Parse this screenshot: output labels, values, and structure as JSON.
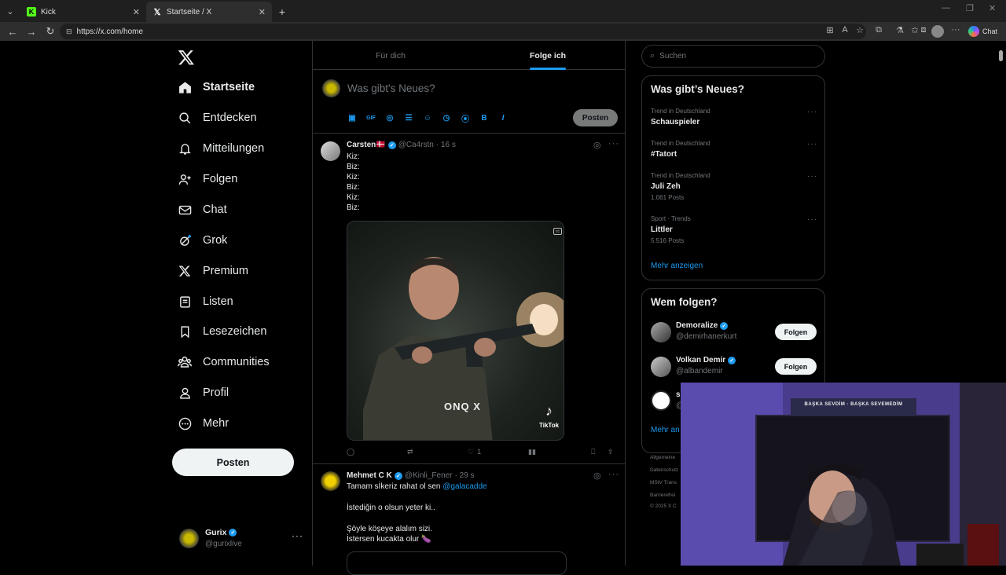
{
  "browser": {
    "tabs": [
      {
        "label": "Kick",
        "active": false
      },
      {
        "label": "Startseite / X",
        "active": true
      }
    ],
    "url": "https://x.com/home",
    "chat_label": "Chat"
  },
  "nav": {
    "items": [
      {
        "label": "Startseite",
        "icon": "home-icon",
        "bold": true
      },
      {
        "label": "Entdecken",
        "icon": "search-icon"
      },
      {
        "label": "Mitteilungen",
        "icon": "bell-icon"
      },
      {
        "label": "Folgen",
        "icon": "follow-icon"
      },
      {
        "label": "Chat",
        "icon": "mail-icon"
      },
      {
        "label": "Grok",
        "icon": "grok-icon"
      },
      {
        "label": "Premium",
        "icon": "x-premium-icon"
      },
      {
        "label": "Listen",
        "icon": "list-icon"
      },
      {
        "label": "Lesezeichen",
        "icon": "bookmark-icon"
      },
      {
        "label": "Communities",
        "icon": "communities-icon"
      },
      {
        "label": "Profil",
        "icon": "profile-icon"
      },
      {
        "label": "Mehr",
        "icon": "more-circle-icon"
      }
    ],
    "post_label": "Posten",
    "account": {
      "name": "Gurix",
      "handle": "@gurixlive"
    }
  },
  "feed": {
    "tabs": [
      {
        "label": "Für dich",
        "active": false
      },
      {
        "label": "Folge ich",
        "active": true
      }
    ],
    "compose_placeholder": "Was gibt's Neues?",
    "compose_post_label": "Posten",
    "tweets": [
      {
        "name": "Carsten🇩🇰",
        "handle": "@Ca4rstn",
        "time": "· 16 s",
        "lines": [
          "Kiz:",
          "Biz:",
          "Kiz:",
          "Biz:",
          "Kiz:",
          "Biz:"
        ],
        "media_caption": "ONQ X",
        "media_watermark": "TikTok",
        "likes": "1"
      },
      {
        "name": "Mehmet C K",
        "handle": "@Kinli_Fener",
        "time": "· 29 s",
        "line1": "Tamam sİkeriz rahat ol sen",
        "mention": "@galacadde",
        "lines": [
          "İstediğin o olsun yeter ki..",
          "",
          "Şöyle köşeye alalım sizi.",
          "İstersen kucakta olur 🍆"
        ]
      }
    ]
  },
  "right": {
    "search_placeholder": "Suchen",
    "trends_title": "Was gibt’s Neues?",
    "trends": [
      {
        "meta": "Trend in Deutschland",
        "name": "Schauspieler",
        "count": ""
      },
      {
        "meta": "Trend in Deutschland",
        "name": "#Tatort",
        "count": ""
      },
      {
        "meta": "Trend in Deutschland",
        "name": "Juli Zeh",
        "count": "1.061 Posts"
      },
      {
        "meta": "Sport · Trends",
        "name": "Littler",
        "count": "5.516 Posts"
      }
    ],
    "show_more": "Mehr anzeigen",
    "who_title": "Wem folgen?",
    "who": [
      {
        "name": "Demoralize",
        "handle": "@demirhanerkurt",
        "button": "Folgen"
      },
      {
        "name": "Volkan Demir",
        "handle": "@albandemir",
        "button": "Folgen"
      },
      {
        "name": "s",
        "handle": "@",
        "button": ""
      }
    ],
    "who_more": "Mehr an",
    "footer": [
      "Allgemeine",
      "Datenschutz",
      "MStV Trans",
      "Barrierefrei",
      "© 2025 X C"
    ]
  },
  "webcam": {
    "sign": "BAŞKA SEVDİM · BAŞKA SEVEMEDİM"
  },
  "colors": {
    "accent": "#1d9bf0",
    "background": "#000000",
    "border": "#2f3336",
    "muted": "#71767b"
  }
}
